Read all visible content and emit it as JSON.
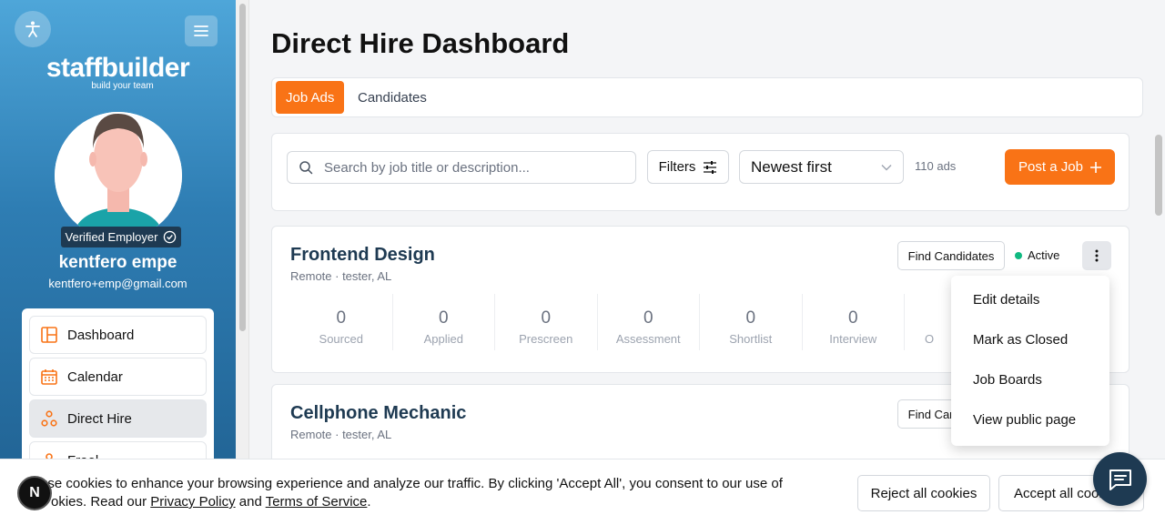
{
  "sidebar": {
    "logo_text": "staffbuilder",
    "logo_tagline": "build your team",
    "verified_label": "Verified Employer",
    "user_name": "kentfero empe",
    "user_email": "kentfero+emp@gmail.com",
    "nav": [
      {
        "label": "Dashboard",
        "icon": "dashboard-icon"
      },
      {
        "label": "Calendar",
        "icon": "calendar-icon"
      },
      {
        "label": "Direct Hire",
        "icon": "direct-hire-icon",
        "active": true
      },
      {
        "label": "Freel",
        "icon": "freelance-icon"
      }
    ]
  },
  "main": {
    "title": "Direct Hire Dashboard",
    "tabs": [
      {
        "label": "Job Ads",
        "active": true
      },
      {
        "label": "Candidates"
      }
    ],
    "search_placeholder": "Search by job title or description...",
    "filters_label": "Filters",
    "sort_value": "Newest first",
    "ads_count": "110 ads",
    "post_job_label": "Post a Job"
  },
  "jobs": [
    {
      "title": "Frontend Design",
      "location": "Remote · tester, AL",
      "find_label": "Find Candidates",
      "status": "Active",
      "stats": [
        {
          "value": "0",
          "label": "Sourced"
        },
        {
          "value": "0",
          "label": "Applied"
        },
        {
          "value": "0",
          "label": "Prescreen"
        },
        {
          "value": "0",
          "label": "Assessment"
        },
        {
          "value": "0",
          "label": "Shortlist"
        },
        {
          "value": "0",
          "label": "Interview"
        },
        {
          "value": "",
          "label": "O"
        }
      ]
    },
    {
      "title": "Cellphone Mechanic",
      "location": "Remote · tester, AL",
      "find_label": "Find Candidates"
    }
  ],
  "dropdown": [
    "Edit details",
    "Mark as Closed",
    "Job Boards",
    "View public page"
  ],
  "cookie": {
    "text_before": "use cookies to enhance your browsing experience and analyze our traffic. By clicking 'Accept All', you consent to our use of",
    "text_line2_prefix": "okies. Read our ",
    "privacy": "Privacy Policy",
    "and": " and ",
    "terms": "Terms of Service",
    "period": ".",
    "reject_label": "Reject all cookies",
    "accept_label": "Accept all cookies"
  },
  "badge_letter": "N",
  "colors": {
    "accent": "#f97316",
    "navy": "#1e3a52",
    "active_dot": "#10b981"
  }
}
